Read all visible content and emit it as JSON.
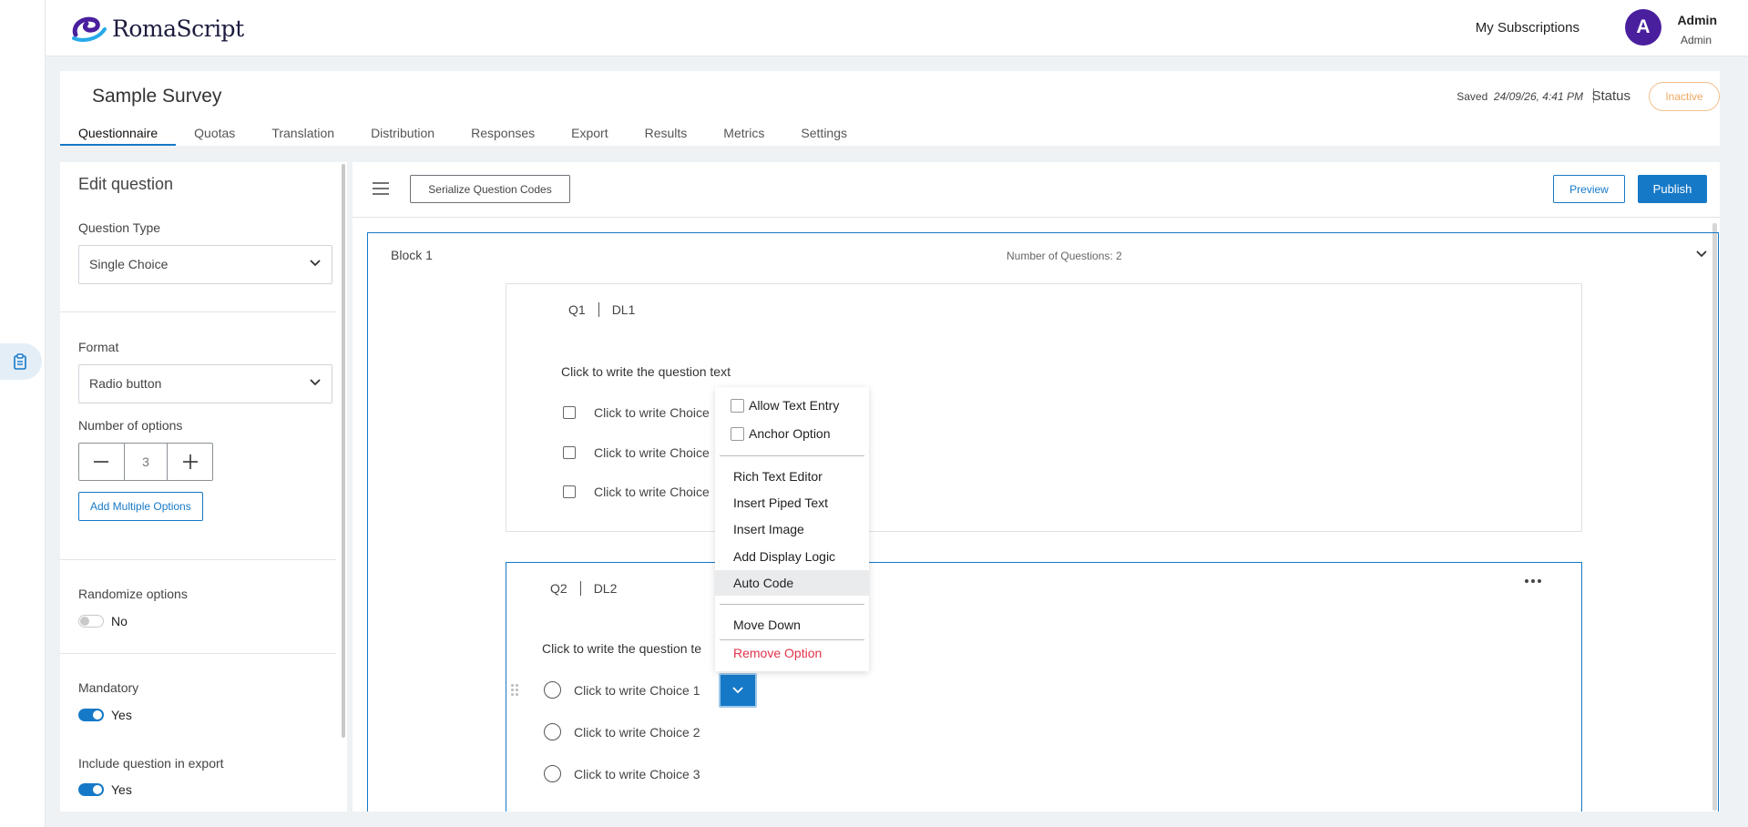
{
  "app": {
    "logo_text": "RomaScript"
  },
  "header": {
    "subscriptions_label": "My Subscriptions",
    "avatar_initial": "A",
    "user_name": "Admin",
    "user_role": "Admin"
  },
  "survey": {
    "title": "Sample Survey",
    "saved_label": "Saved",
    "saved_time": "24/09/26, 4:41 PM",
    "status_label": "Status",
    "status_value": "Inactive",
    "status_color": "#f0a860",
    "tabs": [
      {
        "label": "Questionnaire",
        "active": true
      },
      {
        "label": "Quotas"
      },
      {
        "label": "Translation"
      },
      {
        "label": "Distribution"
      },
      {
        "label": "Responses"
      },
      {
        "label": "Export"
      },
      {
        "label": "Results"
      },
      {
        "label": "Metrics"
      },
      {
        "label": "Settings"
      }
    ]
  },
  "edit_panel": {
    "title": "Edit question",
    "question_type_label": "Question Type",
    "question_type_value": "Single Choice",
    "format_label": "Format",
    "format_value": "Radio button",
    "num_options_label": "Number of options",
    "num_options_value": "3",
    "add_multiple_label": "Add Multiple Options",
    "randomize_label": "Randomize options",
    "randomize_value": "No",
    "mandatory_label": "Mandatory",
    "mandatory_value": "Yes",
    "include_export_label": "Include question in export",
    "include_export_value": "Yes"
  },
  "toolbar": {
    "serialize_label": "Serialize Question Codes",
    "preview_label": "Preview",
    "publish_label": "Publish"
  },
  "block": {
    "title": "Block 1",
    "count_label": "Number of Questions: 2"
  },
  "questions": [
    {
      "code": "Q1",
      "logic": "DL1",
      "text": "Click to write the question text",
      "choices": [
        "Click to write Choice",
        "Click to write Choice",
        "Click to write Choice"
      ]
    },
    {
      "code": "Q2",
      "logic": "DL2",
      "text": "Click to write the question te",
      "choices": [
        "Click to write Choice 1",
        "Click to write Choice 2",
        "Click to write Choice 3"
      ]
    }
  ],
  "context_menu": {
    "allow_text_entry": "Allow Text Entry",
    "anchor_option": "Anchor Option",
    "rich_text_editor": "Rich Text Editor",
    "insert_piped_text": "Insert Piped Text",
    "insert_image": "Insert Image",
    "add_display_logic": "Add Display Logic",
    "auto_code": "Auto Code",
    "move_down": "Move Down",
    "remove_option": "Remove Option"
  },
  "colors": {
    "accent": "#1679c7",
    "brand_purple": "#4a1f9e",
    "danger": "#e0344b"
  },
  "icons": [
    "clipboard-icon",
    "hamburger-icon",
    "chevron-down-icon",
    "minus-icon",
    "plus-icon",
    "more-dots-icon",
    "drag-handle-icon",
    "caret-down-icon"
  ]
}
